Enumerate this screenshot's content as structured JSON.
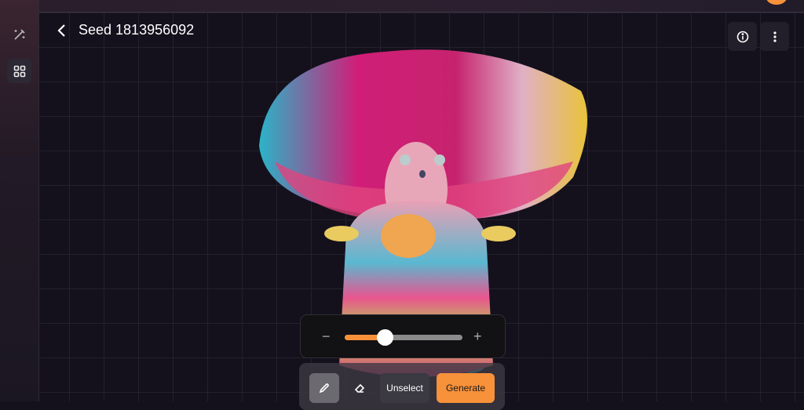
{
  "header": {
    "title": "Seed 1813956092",
    "back_icon": "chevron-left-icon"
  },
  "sidebar": {
    "items": [
      {
        "icon": "magic-wand-icon",
        "active": false
      },
      {
        "icon": "grid-icon",
        "active": true
      }
    ]
  },
  "actions": {
    "info_icon": "info-icon",
    "more_icon": "more-vertical-icon"
  },
  "slider": {
    "value_percent": 34,
    "minus": "−",
    "plus": "+"
  },
  "toolbar": {
    "brush_icon": "brush-icon",
    "eraser_icon": "eraser-icon",
    "unselect_label": "Unselect",
    "generate_label": "Generate"
  },
  "colors": {
    "accent": "#f7913a",
    "background": "#14111d"
  }
}
